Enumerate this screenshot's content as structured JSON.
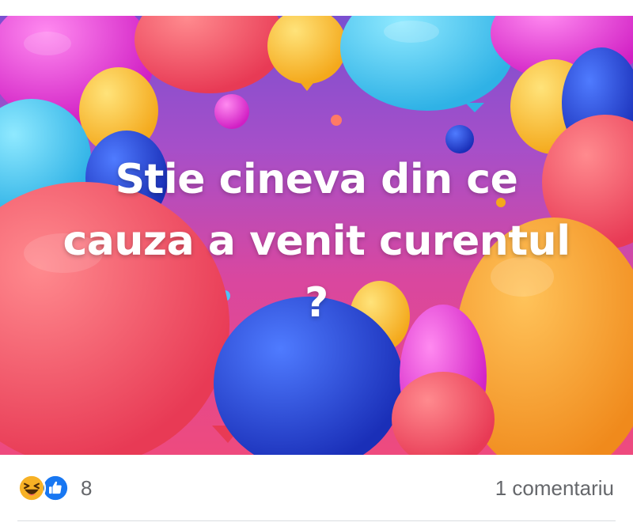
{
  "post": {
    "text_lines": [
      "Stie cineva din ce",
      "cauza a venit curentul",
      "?"
    ],
    "background_colors": {
      "top": "#7a4fd0",
      "middle": "#d9479f",
      "bottom": "#ee4a7e"
    }
  },
  "reactions": {
    "icons": [
      "haha-icon",
      "like-icon"
    ],
    "count": "8",
    "colors": {
      "haha": "#f7b125",
      "like": "#1877f2"
    }
  },
  "comments": {
    "label": "1 comentariu"
  }
}
